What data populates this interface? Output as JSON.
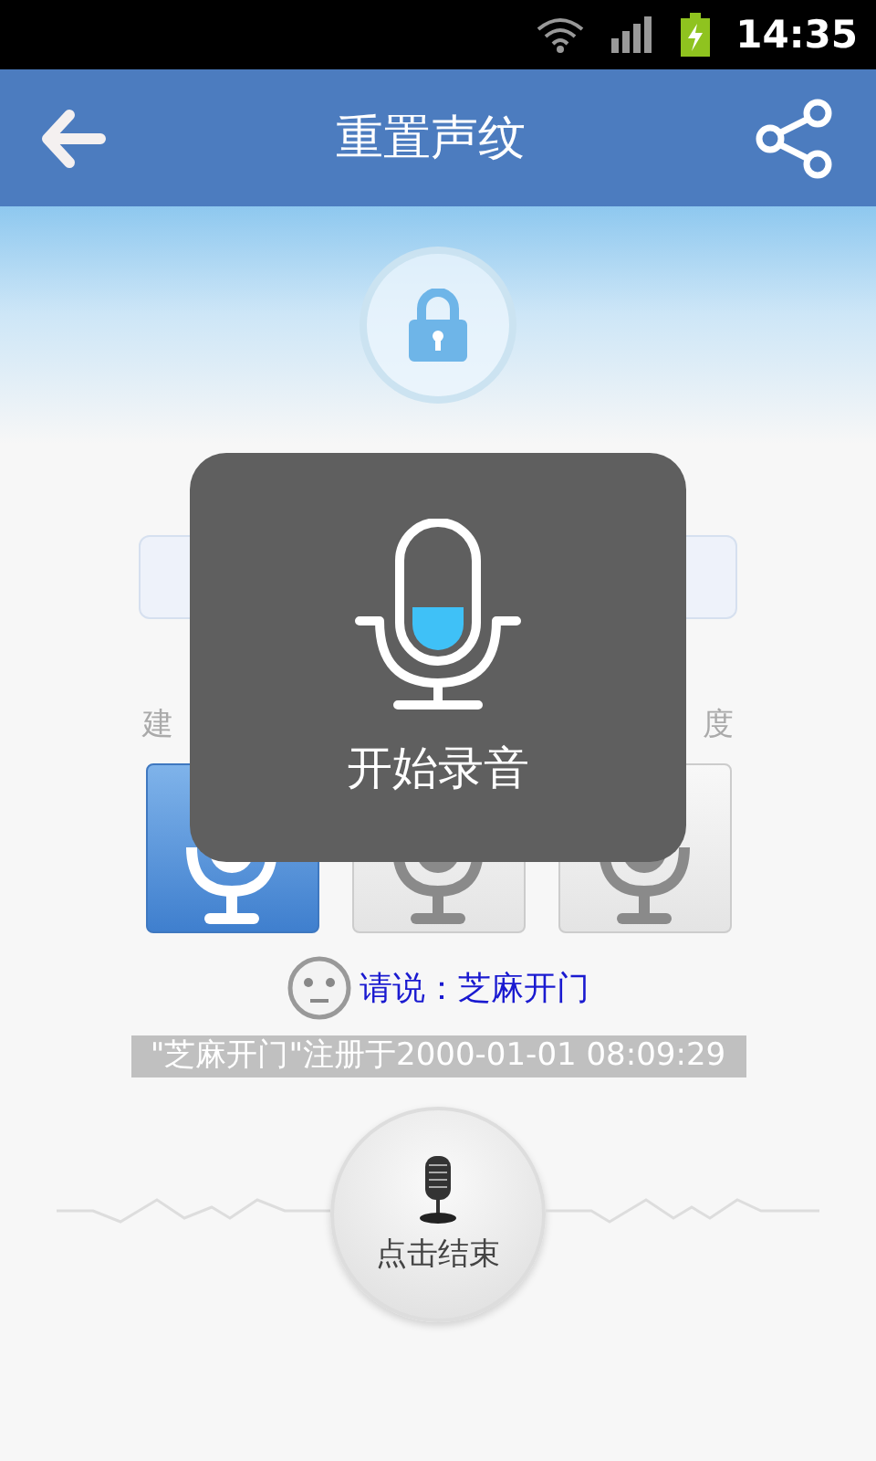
{
  "status_bar": {
    "time": "14:35"
  },
  "header": {
    "title": "重置声纹"
  },
  "hint": {
    "left": "建",
    "right": "度"
  },
  "mic_buttons": [
    {
      "selected": true
    },
    {
      "selected": false
    },
    {
      "selected": false
    }
  ],
  "prompt": "请说：芝麻开门",
  "registered_note": "\"芝麻开门\"注册于2000-01-01 08:09:29",
  "end_button": {
    "label": "点击结束"
  },
  "recording_dialog": {
    "label": "开始录音",
    "level": 0.55
  }
}
